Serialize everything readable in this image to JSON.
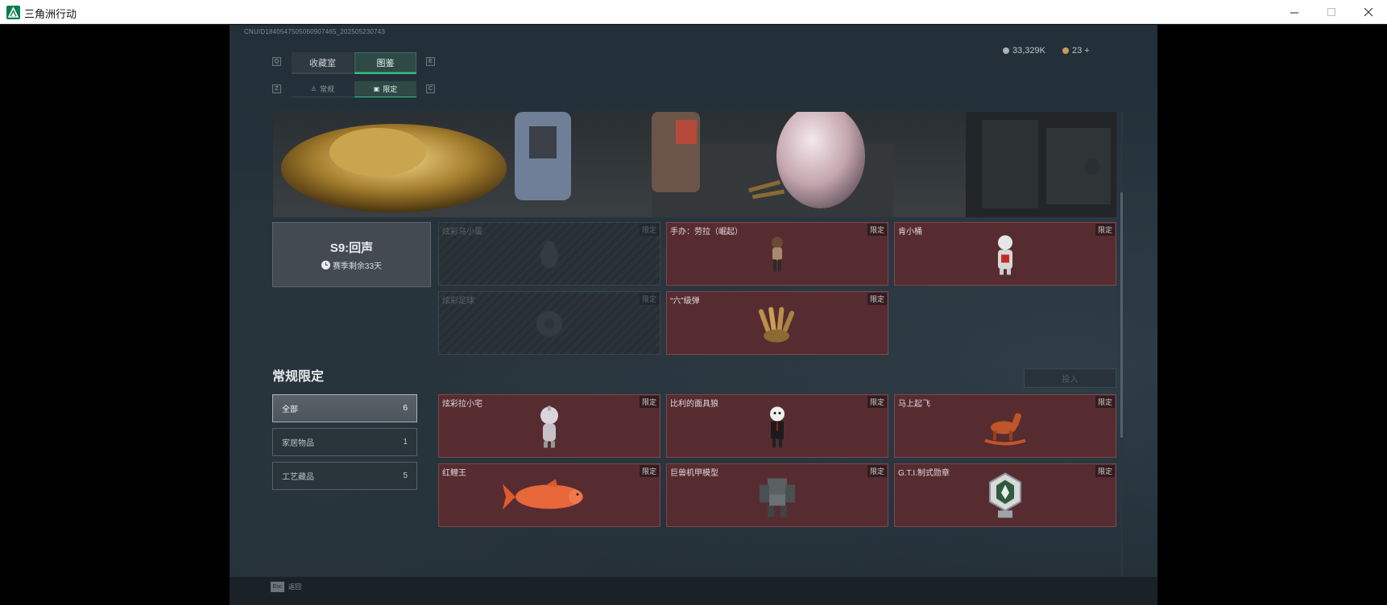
{
  "window": {
    "title": "三角洲行动"
  },
  "header": {
    "uid": "CNUID1840547505060907465_202505230743",
    "currency_1": "33,329K",
    "currency_2": "23 +",
    "key_q": "Q",
    "key_e": "E",
    "key_z": "Z",
    "key_c": "C"
  },
  "tabs": [
    {
      "label": "收藏室"
    },
    {
      "label": "图鉴",
      "active": true
    }
  ],
  "subtabs": [
    {
      "label": "常规"
    },
    {
      "label": "限定",
      "active": true
    }
  ],
  "season": {
    "title": "S9:回声",
    "remaining": "赛季剩余33天"
  },
  "limited_cards": [
    {
      "name": "炫彩乌小蛋",
      "badge": "限定",
      "locked": true,
      "icon": "egg-figurine-icon"
    },
    {
      "name": "手办：劳拉（崛起）",
      "badge": "限定",
      "locked": false,
      "icon": "lara-figurine-icon"
    },
    {
      "name": "肯小桶",
      "badge": "限定",
      "locked": false,
      "icon": "colonel-figurine-icon"
    },
    {
      "name": "炫彩足球",
      "badge": "限定",
      "locked": true,
      "icon": "football-icon"
    },
    {
      "name": "“六”级弹",
      "badge": "限定",
      "locked": false,
      "icon": "bullet-hand-icon"
    }
  ],
  "section": {
    "title": "常规限定",
    "exchange_label": "投入"
  },
  "filters": [
    {
      "label": "全部",
      "count": "6",
      "active": true
    },
    {
      "label": "家居物品",
      "count": "1"
    },
    {
      "label": "工艺藏品",
      "count": "5"
    }
  ],
  "regular_cards": [
    {
      "name": "炫彩拉小宅",
      "badge": "限定",
      "icon": "doll-icon"
    },
    {
      "name": "比利的面具狼",
      "badge": "限定",
      "icon": "puppet-icon"
    },
    {
      "name": "马上起飞",
      "badge": "限定",
      "icon": "rocking-horse-icon"
    },
    {
      "name": "红鲤王",
      "badge": "限定",
      "icon": "koi-fish-icon"
    },
    {
      "name": "巨兽机甲模型",
      "badge": "限定",
      "icon": "mech-model-icon"
    },
    {
      "name": "G.T.I.制式勋章",
      "badge": "限定",
      "icon": "medal-icon"
    }
  ],
  "footer": {
    "esc_key": "Esc",
    "esc_label": "返回"
  },
  "colors": {
    "card_bg": "#562c31",
    "accent_green": "#2ec77d",
    "game_bg": "#243039"
  }
}
